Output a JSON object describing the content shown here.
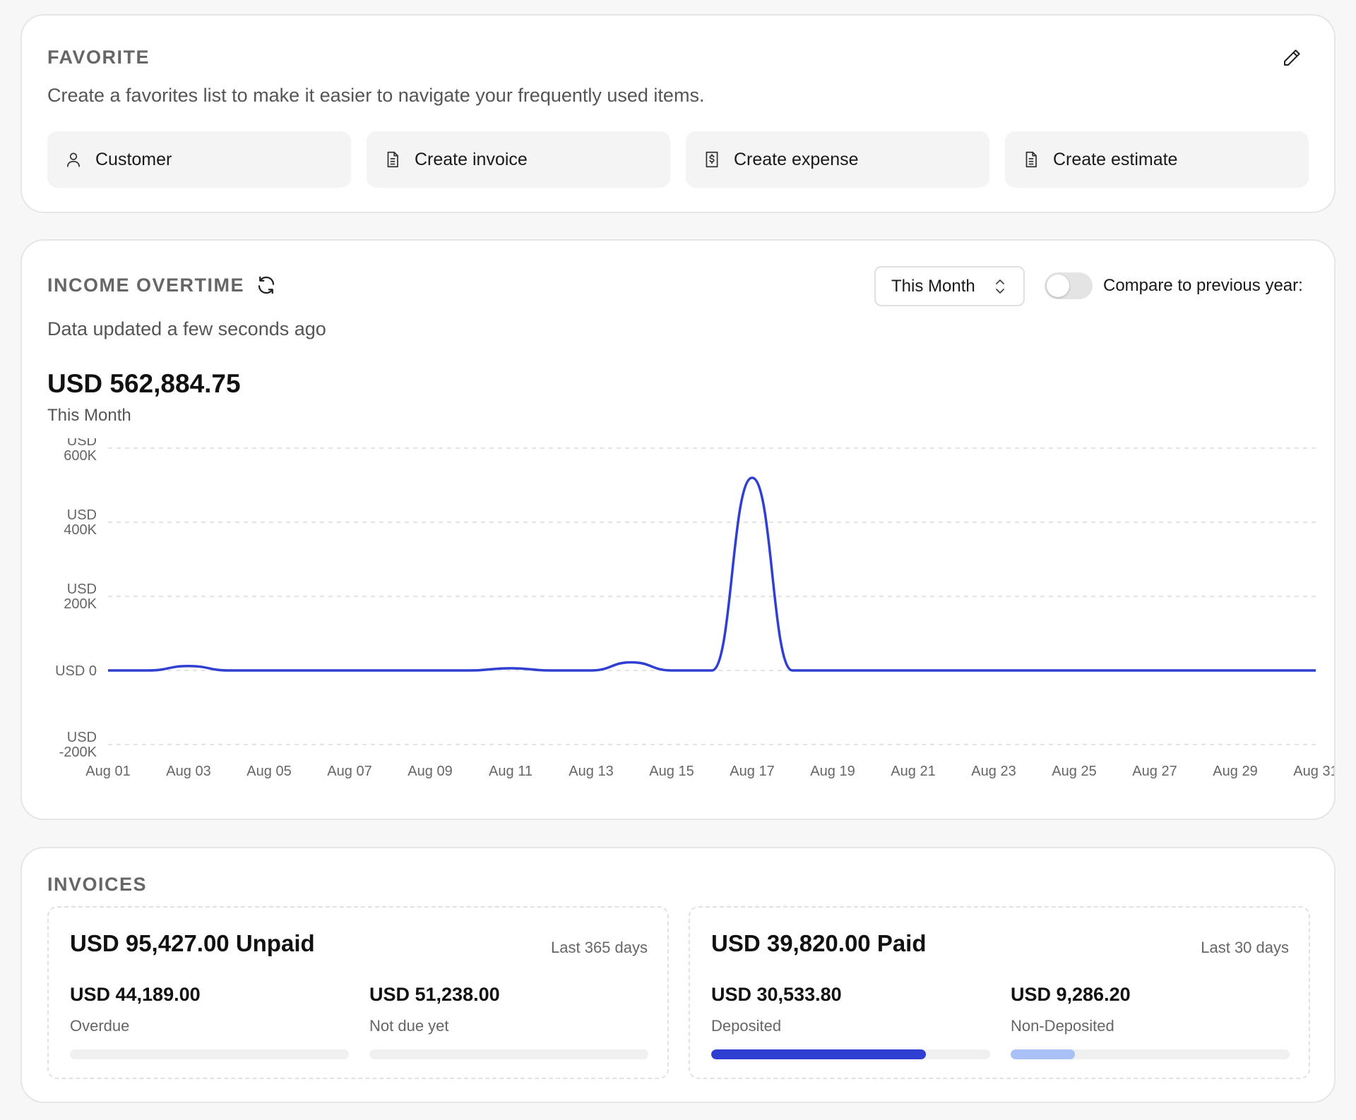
{
  "favorite": {
    "title": "FAVORITE",
    "subtitle": "Create a favorites list to make it easier to navigate your frequently used items.",
    "edit_icon": "pencil-icon",
    "items": [
      {
        "label": "Customer",
        "icon": "user-icon"
      },
      {
        "label": "Create invoice",
        "icon": "document-icon"
      },
      {
        "label": "Create expense",
        "icon": "dollar-document-icon"
      },
      {
        "label": "Create estimate",
        "icon": "document-icon"
      }
    ]
  },
  "income": {
    "title": "INCOME OVERTIME",
    "refresh_icon": "refresh-icon",
    "range_select": "This Month",
    "compare_label": "Compare to previous year:",
    "compare_enabled": false,
    "updated": "Data updated a few seconds ago",
    "total": "USD 562,884.75",
    "period": "This Month"
  },
  "chart_data": {
    "type": "line",
    "color": "#2f3fd1",
    "ylim": [
      -200000,
      600000
    ],
    "y_ticks": [
      {
        "value": 600000,
        "label": [
          "USD",
          "600K"
        ]
      },
      {
        "value": 400000,
        "label": [
          "USD",
          "400K"
        ]
      },
      {
        "value": 200000,
        "label": [
          "USD",
          "200K"
        ]
      },
      {
        "value": 0,
        "label": [
          "USD 0"
        ]
      },
      {
        "value": -200000,
        "label": [
          "USD",
          "-200K"
        ]
      }
    ],
    "x_ticks": [
      {
        "day": 1,
        "label": "Aug 01"
      },
      {
        "day": 3,
        "label": "Aug 03"
      },
      {
        "day": 5,
        "label": "Aug 05"
      },
      {
        "day": 7,
        "label": "Aug 07"
      },
      {
        "day": 9,
        "label": "Aug 09"
      },
      {
        "day": 11,
        "label": "Aug 11"
      },
      {
        "day": 13,
        "label": "Aug 13"
      },
      {
        "day": 15,
        "label": "Aug 15"
      },
      {
        "day": 17,
        "label": "Aug 17"
      },
      {
        "day": 19,
        "label": "Aug 19"
      },
      {
        "day": 21,
        "label": "Aug 21"
      },
      {
        "day": 23,
        "label": "Aug 23"
      },
      {
        "day": 25,
        "label": "Aug 25"
      },
      {
        "day": 27,
        "label": "Aug 27"
      },
      {
        "day": 29,
        "label": "Aug 29"
      },
      {
        "day": 31,
        "label": "Aug 31"
      }
    ],
    "x": [
      1,
      2,
      3,
      4,
      5,
      6,
      7,
      8,
      9,
      10,
      11,
      12,
      13,
      14,
      15,
      16,
      17,
      18,
      19,
      20,
      21,
      22,
      23,
      24,
      25,
      26,
      27,
      28,
      29,
      30,
      31
    ],
    "series": [
      {
        "values": [
          0,
          0,
          12000,
          0,
          0,
          0,
          0,
          0,
          0,
          0,
          6000,
          0,
          0,
          22000,
          0,
          0,
          520000,
          0,
          0,
          0,
          0,
          0,
          0,
          0,
          0,
          0,
          0,
          0,
          0,
          0,
          0
        ]
      }
    ]
  },
  "invoices": {
    "title": "INVOICES",
    "unpaid": {
      "headline": "USD 95,427.00 Unpaid",
      "range": "Last 365 days",
      "left": {
        "amount": "USD 44,189.00",
        "label": "Overdue",
        "fraction": 0,
        "color": "#2f3fd1"
      },
      "right": {
        "amount": "USD 51,238.00",
        "label": "Not due yet",
        "fraction": 0,
        "color": "#a9c1f7"
      }
    },
    "paid": {
      "headline": "USD 39,820.00 Paid",
      "range": "Last 30 days",
      "left": {
        "amount": "USD 30,533.80",
        "label": "Deposited",
        "fraction": 0.77,
        "color": "#2f3fd1"
      },
      "right": {
        "amount": "USD 9,286.20",
        "label": "Non-Deposited",
        "fraction": 0.23,
        "color": "#a9c1f7"
      }
    }
  }
}
